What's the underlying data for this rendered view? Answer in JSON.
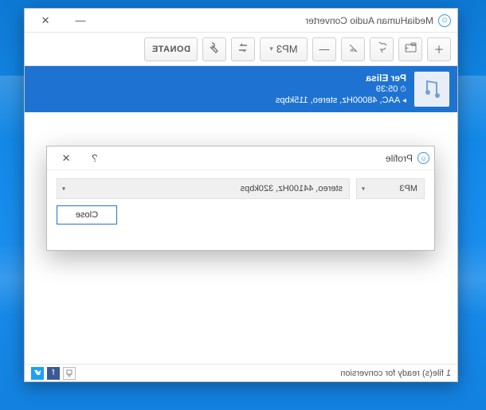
{
  "window": {
    "title": "MediaHuman Audio Converter"
  },
  "toolbar": {
    "format_label": "MP3",
    "donate_label": "DONATE"
  },
  "track": {
    "name": "Per Elisa",
    "duration": "05:39",
    "format": "AAC, 48000Hz, stereo, 115kbps"
  },
  "dialog": {
    "title": "Profile",
    "format_value": "MP3",
    "quality_value": "stereo, 44100Hz, 320kbps",
    "close_label": "Close"
  },
  "status": {
    "text": "1 file(s) ready for conversion"
  }
}
